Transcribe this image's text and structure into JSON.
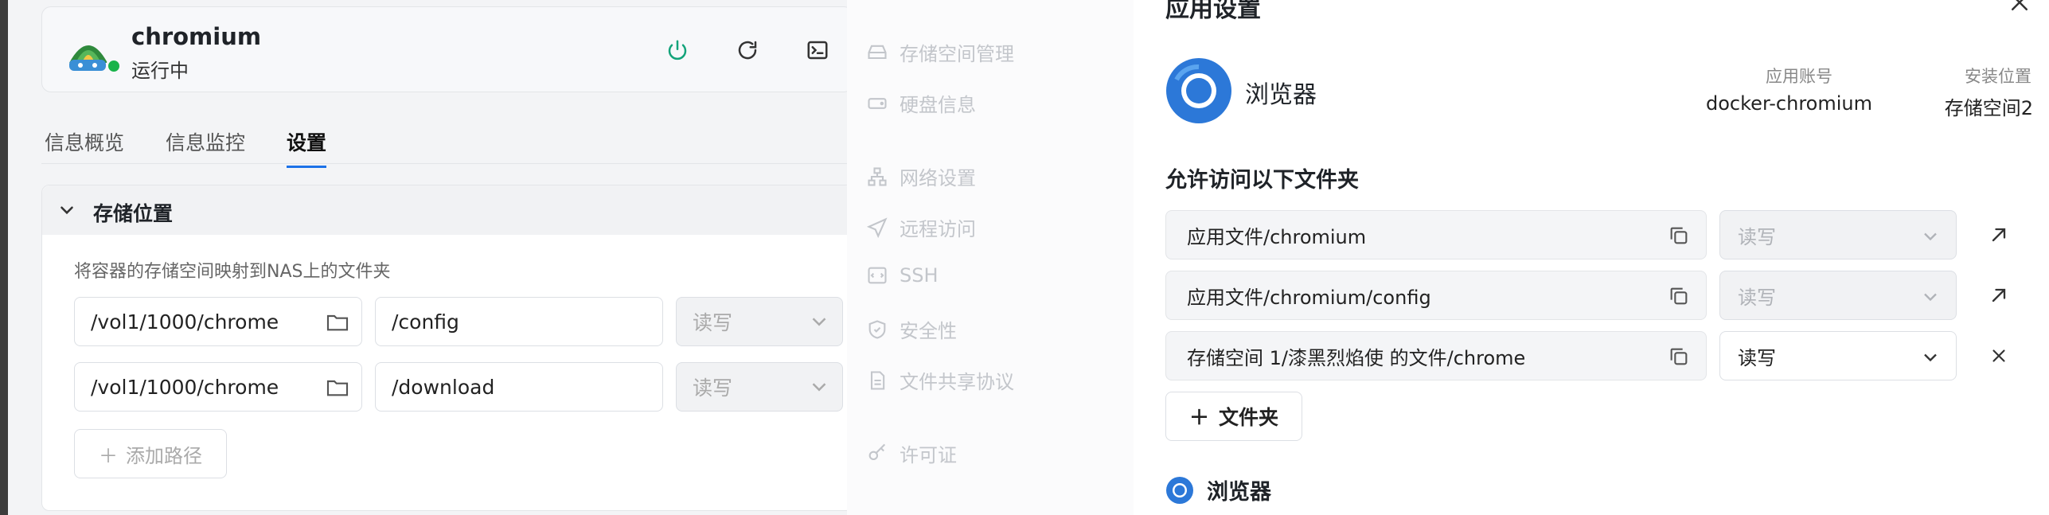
{
  "app_card": {
    "name": "chromium",
    "status": "运行中"
  },
  "tabs": [
    {
      "label": "信息概览"
    },
    {
      "label": "信息监控"
    },
    {
      "label": "设置",
      "active": true
    }
  ],
  "storage": {
    "title": "存储位置",
    "description": "将容器的存储空间映射到NAS上的文件夹",
    "rows": [
      {
        "host": "/vol1/1000/chrome",
        "container": "/config",
        "permission": "读写"
      },
      {
        "host": "/vol1/1000/chrome",
        "container": "/download",
        "permission": "读写"
      }
    ],
    "add_path_label": "添加路径"
  },
  "settings_nav": [
    {
      "label": "存储空间管理",
      "icon": "drive-icon"
    },
    {
      "label": "硬盘信息",
      "icon": "disk-icon"
    },
    {
      "label": "网络设置",
      "icon": "network-icon"
    },
    {
      "label": "远程访问",
      "icon": "send-icon"
    },
    {
      "label": "SSH",
      "icon": "terminal-icon"
    },
    {
      "label": "安全性",
      "icon": "shield-icon"
    },
    {
      "label": "文件共享协议",
      "icon": "file-icon"
    },
    {
      "label": "许可证",
      "icon": "key-icon"
    }
  ],
  "dialog": {
    "title": "应用设置",
    "app_name": "浏览器",
    "account_label": "应用账号",
    "account_value": "docker-chromium",
    "location_label": "安装位置",
    "location_value": "存储空间2",
    "section_title": "允许访问以下文件夹",
    "folders": [
      {
        "path": "应用文件/chromium",
        "permission": "读写",
        "editable": false,
        "action": "open-external-icon"
      },
      {
        "path": "应用文件/chromium/config",
        "permission": "读写",
        "editable": false,
        "action": "open-external-icon"
      },
      {
        "path": "存储空间 1/漆黑烈焰使 的文件/chrome",
        "permission": "读写",
        "editable": true,
        "action": "close-icon"
      }
    ],
    "add_folder_label": "文件夹",
    "sub_app_name": "浏览器"
  },
  "colors": {
    "accent": "#1c72e8",
    "running": "#19b34a",
    "power": "#13a37a"
  }
}
